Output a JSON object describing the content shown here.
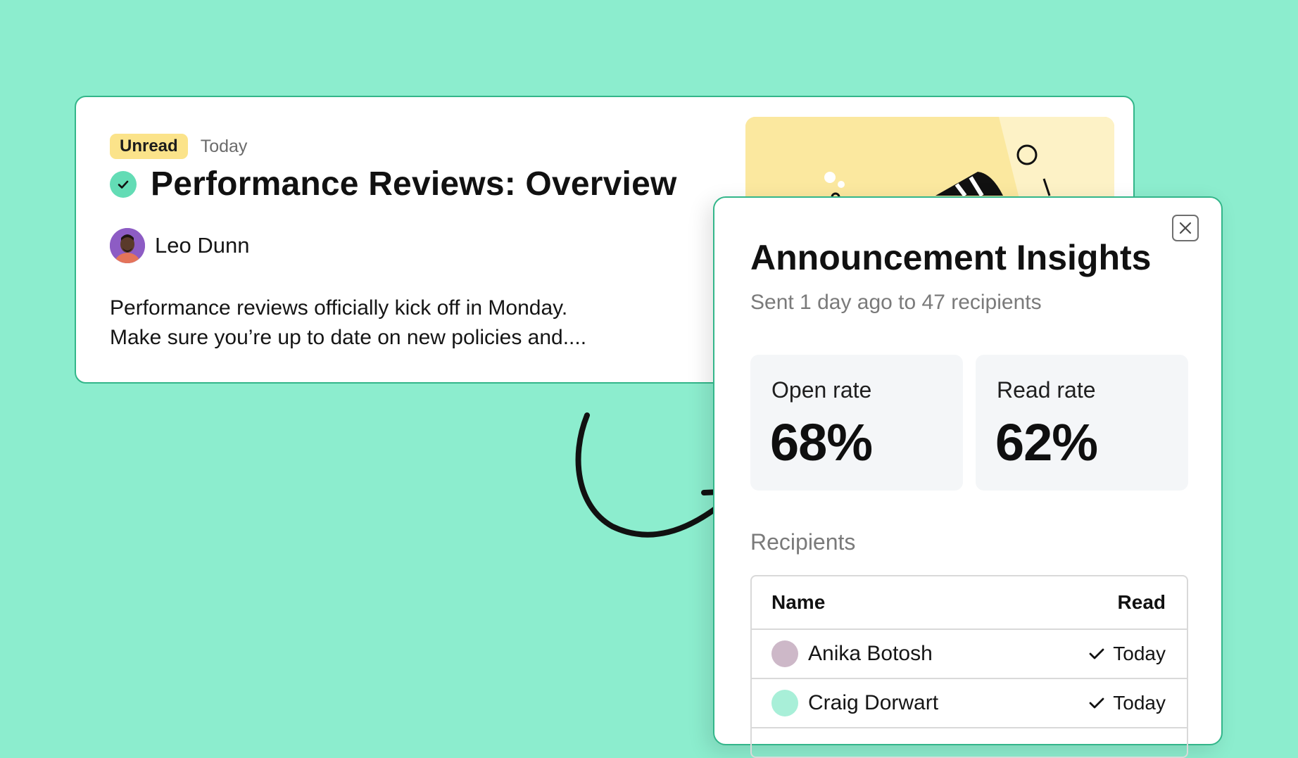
{
  "announcement": {
    "badge": "Unread",
    "date": "Today",
    "title": "Performance Reviews: Overview",
    "author": "Leo Dunn",
    "excerpt_line1": "Performance reviews officially kick off in Monday.",
    "excerpt_line2": "Make sure you’re up to date on new policies and...."
  },
  "insights": {
    "title": "Announcement Insights",
    "subtitle": "Sent 1 day ago to 47 recipients",
    "stats": [
      {
        "label": "Open rate",
        "value": "68%"
      },
      {
        "label": "Read rate",
        "value": "62%"
      }
    ],
    "recipients_label": "Recipients",
    "table": {
      "col_name": "Name",
      "col_read": "Read",
      "rows": [
        {
          "name": "Anika Botosh",
          "read": "Today",
          "dot_color": "#cdb8c8"
        },
        {
          "name": "Craig Dorwart",
          "read": "Today",
          "dot_color": "#a8efd8"
        }
      ]
    }
  },
  "icons": {
    "close": "close-icon",
    "check_badge": "check-circle-icon",
    "read_check": "checkmark-icon",
    "arrow": "curved-arrow-icon"
  },
  "colors": {
    "background": "#8cedce",
    "accent_green": "#33b68a",
    "badge_yellow": "#fbe38a"
  }
}
